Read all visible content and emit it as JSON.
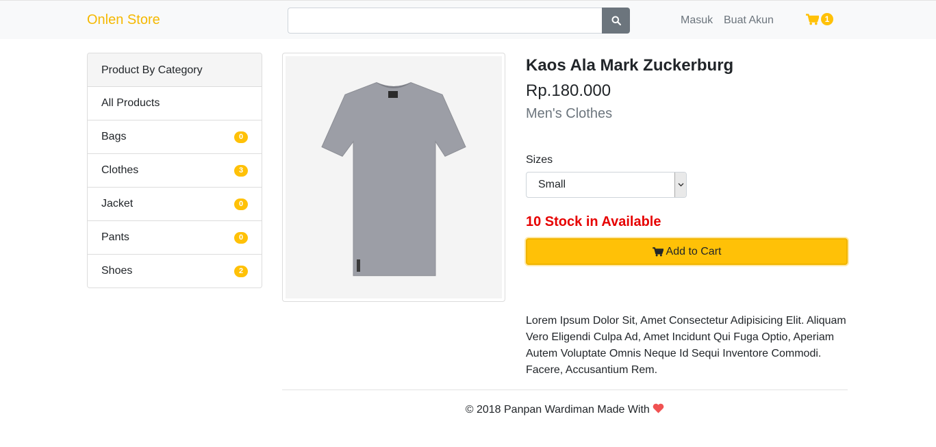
{
  "navbar": {
    "brand": "Onlen Store",
    "search": {
      "value": "",
      "placeholder": ""
    },
    "login": "Masuk",
    "register": "Buat Akun",
    "cart_count": "1"
  },
  "sidebar": {
    "title": "Product By Category",
    "items": [
      {
        "label": "All Products",
        "count": null
      },
      {
        "label": "Bags",
        "count": "0"
      },
      {
        "label": "Clothes",
        "count": "3"
      },
      {
        "label": "Jacket",
        "count": "0"
      },
      {
        "label": "Pants",
        "count": "0"
      },
      {
        "label": "Shoes",
        "count": "2"
      }
    ]
  },
  "product": {
    "title": "Kaos Ala Mark Zuckerburg",
    "price": "Rp.180.000",
    "category": "Men's Clothes",
    "sizes_label": "Sizes",
    "selected_size": "Small",
    "stock": "10 Stock in Available",
    "add_to_cart": "Add to Cart",
    "description": "Lorem Ipsum Dolor Sit, Amet Consectetur Adipisicing Elit. Aliquam Vero Eligendi Culpa Ad, Amet Incidunt Qui Fuga Optio, Aperiam Autem Voluptate Omnis Neque Id Sequi Inventore Commodi. Facere, Accusantium Rem."
  },
  "footer": {
    "text": "© 2018 Panpan Wardiman Made With"
  },
  "colors": {
    "accent": "#ffc107",
    "brand": "#f5b800",
    "stock": "#e60000",
    "heart": "#f05252"
  }
}
